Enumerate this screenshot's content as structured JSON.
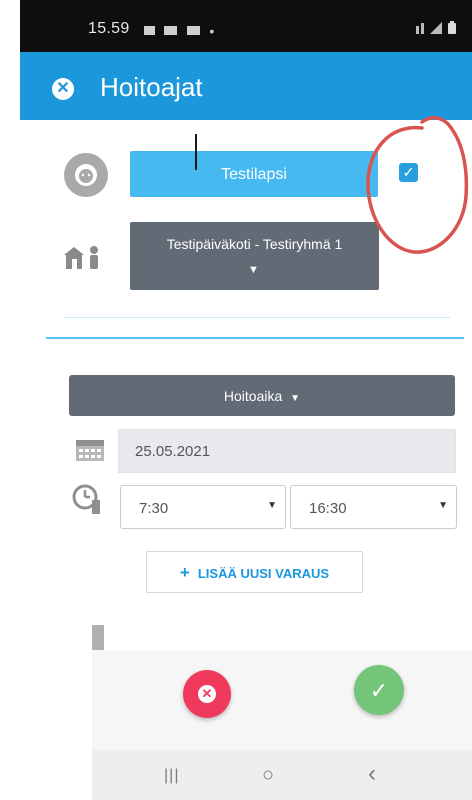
{
  "status_bar": {
    "time": "15.59",
    "dot": "•"
  },
  "app_bar": {
    "title": "Hoitoajat",
    "close_icon": "close-circle-icon"
  },
  "child": {
    "name": "Testilapsi",
    "selected": true
  },
  "group": {
    "label": "Testipäiväkoti - Testiryhmä 1"
  },
  "care_time": {
    "section_label": "Hoitoaika",
    "date": "25.05.2021",
    "start_time": "7:30",
    "end_time": "16:30"
  },
  "add_reservation": {
    "plus": "+",
    "label": "LISÄÄ UUSI VARAUS"
  },
  "nav": {
    "recents": "|||",
    "home": "○",
    "back": "‹"
  },
  "colors": {
    "app_bar": "#1b97dc",
    "child_button": "#45b9f0",
    "dark_button": "#626a75",
    "cancel": "#ef3a5d",
    "confirm": "#74c47a",
    "annotation": "#d9534f"
  }
}
